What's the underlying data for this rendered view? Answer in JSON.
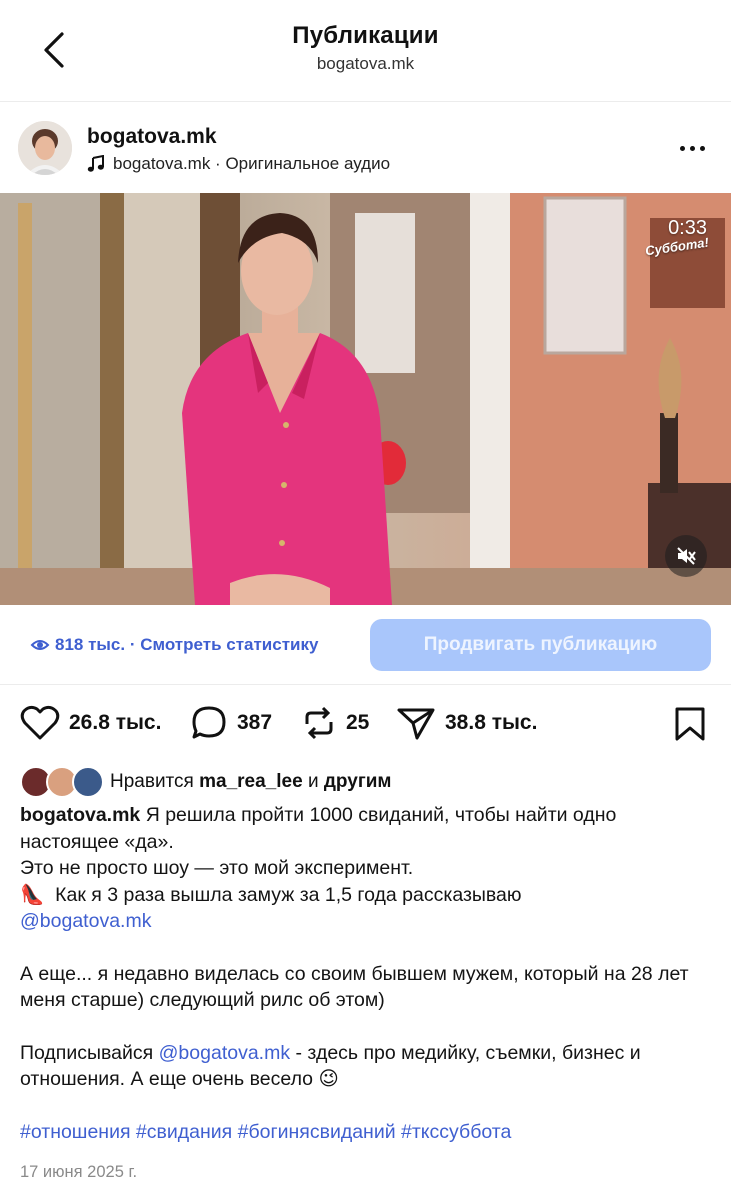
{
  "header": {
    "title": "Публикации",
    "subtitle": "bogatova.mk"
  },
  "post": {
    "username": "bogatova.mk",
    "audio": "bogatova.mk · Оригинальное аудио",
    "video": {
      "timer": "0:33",
      "channel_logo": "Суббота!"
    },
    "views": "818 тыс. · Смотреть статистику",
    "promote_button": "Продвигать публикацию",
    "actions": {
      "likes": "26.8 тыс.",
      "comments": "387",
      "reposts": "25",
      "shares": "38.8 тыс."
    },
    "liked_by": {
      "prefix": "Нравится",
      "user": "ma_rea_lee",
      "conj": "и",
      "others": "другим"
    },
    "caption": {
      "author": "bogatova.mk",
      "line1": "Я решила пройти 1000 свиданий, чтобы найти одно настоящее «да».",
      "line2": "Это не просто шоу — это мой эксперимент.",
      "line3_emoji": "👠",
      "line3": "Как я 3 раза вышла замуж за 1,5 года рассказываю",
      "mention1": "@bogatova.mk",
      "para2": "А еще... я недавно виделась со своим бывшем мужем, который на 28 лет меня старше) следующий рилс об этом)",
      "para3_start": "Подписывайся",
      "mention2": "@bogatova.mk",
      "para3_end": "- здесь про медийку, съемки, бизнес и отношения. А еще очень весело",
      "para3_emoji": "😉",
      "hashtags": "#отношения #свидания #богинясвиданий #ткссуббота"
    },
    "date": "17 июня 2025 г."
  },
  "colors": {
    "link": "#3f5fd0",
    "promote_bg": "#a9c6fb",
    "jacket": "#e4347d"
  },
  "icons": [
    "back-chevron-icon",
    "music-note-icon",
    "more-dots-icon",
    "eye-icon",
    "heart-icon",
    "comment-icon",
    "repost-icon",
    "share-icon",
    "bookmark-icon",
    "mute-icon"
  ]
}
